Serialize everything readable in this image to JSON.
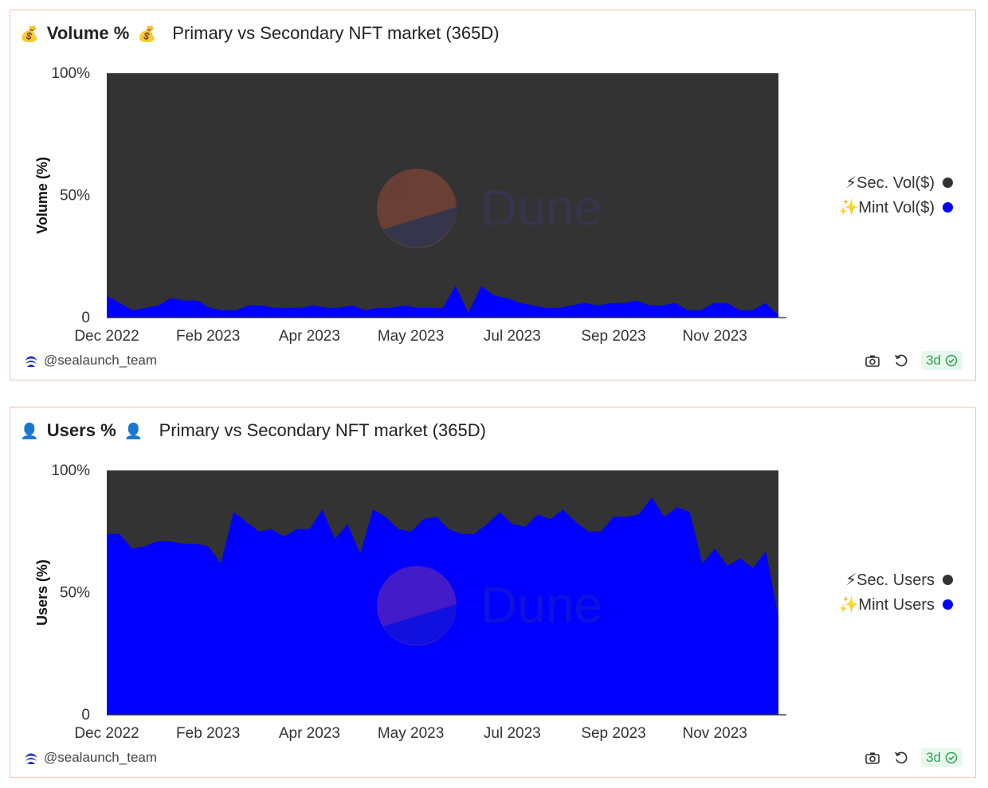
{
  "panels": [
    {
      "title_emoji": "💰",
      "title": "Volume %",
      "subtitle": "Primary vs Secondary NFT market (365D)",
      "author": "@sealaunch_team",
      "age_badge": "3d",
      "icons": [
        "camera-icon",
        "refresh-icon",
        "check-circle-icon"
      ]
    },
    {
      "title_emoji": "👤",
      "title": "Users %",
      "subtitle": "Primary vs Secondary NFT market (365D)",
      "author": "@sealaunch_team",
      "age_badge": "3d",
      "icons": [
        "camera-icon",
        "refresh-icon",
        "check-circle-icon"
      ]
    }
  ],
  "watermark": "Dune",
  "chart_data": [
    {
      "type": "area",
      "stacked": "percent",
      "ylabel": "Volume (%)",
      "yticks": [
        "100%",
        "50%",
        "0"
      ],
      "ylim": [
        0,
        100
      ],
      "xticks": [
        "Dec 2022",
        "Feb 2023",
        "Apr 2023",
        "May 2023",
        "Jul 2023",
        "Sep 2023",
        "Nov 2023"
      ],
      "legend_position": "right",
      "series": [
        {
          "name": "⚡Sec. Vol($)",
          "color": "#333333",
          "values": "complement of Mint Vol($) to 100"
        },
        {
          "name": "✨Mint Vol($)",
          "color": "#0000ff",
          "values": [
            9,
            6,
            3,
            4,
            5,
            8,
            7,
            7,
            4,
            3,
            3,
            5,
            5,
            4,
            4,
            4,
            5,
            4,
            4,
            5,
            3,
            4,
            4,
            5,
            4,
            4,
            4,
            13,
            2,
            13,
            9,
            8,
            6,
            5,
            4,
            4,
            5,
            6,
            5,
            6,
            6,
            7,
            5,
            5,
            6,
            3,
            3,
            6,
            6,
            3,
            3,
            6,
            1
          ]
        }
      ]
    },
    {
      "type": "area",
      "stacked": "percent",
      "ylabel": "Users (%)",
      "yticks": [
        "100%",
        "50%",
        "0"
      ],
      "ylim": [
        0,
        100
      ],
      "xticks": [
        "Dec 2022",
        "Feb 2023",
        "Apr 2023",
        "May 2023",
        "Jul 2023",
        "Sep 2023",
        "Nov 2023"
      ],
      "legend_position": "right",
      "series": [
        {
          "name": "⚡Sec. Users",
          "color": "#333333",
          "values": "complement of Mint Users to 100"
        },
        {
          "name": "✨Mint Users",
          "color": "#0000ff",
          "values": [
            74,
            74,
            68,
            69,
            71,
            71,
            70,
            70,
            69,
            62,
            83,
            79,
            75,
            76,
            73,
            76,
            76,
            84,
            72,
            78,
            66,
            84,
            81,
            76,
            75,
            80,
            81,
            76,
            74,
            74,
            78,
            83,
            78,
            77,
            82,
            80,
            84,
            79,
            75,
            75,
            81,
            81,
            82,
            89,
            81,
            85,
            83,
            62,
            68,
            61,
            64,
            60,
            67,
            40
          ]
        }
      ]
    }
  ]
}
